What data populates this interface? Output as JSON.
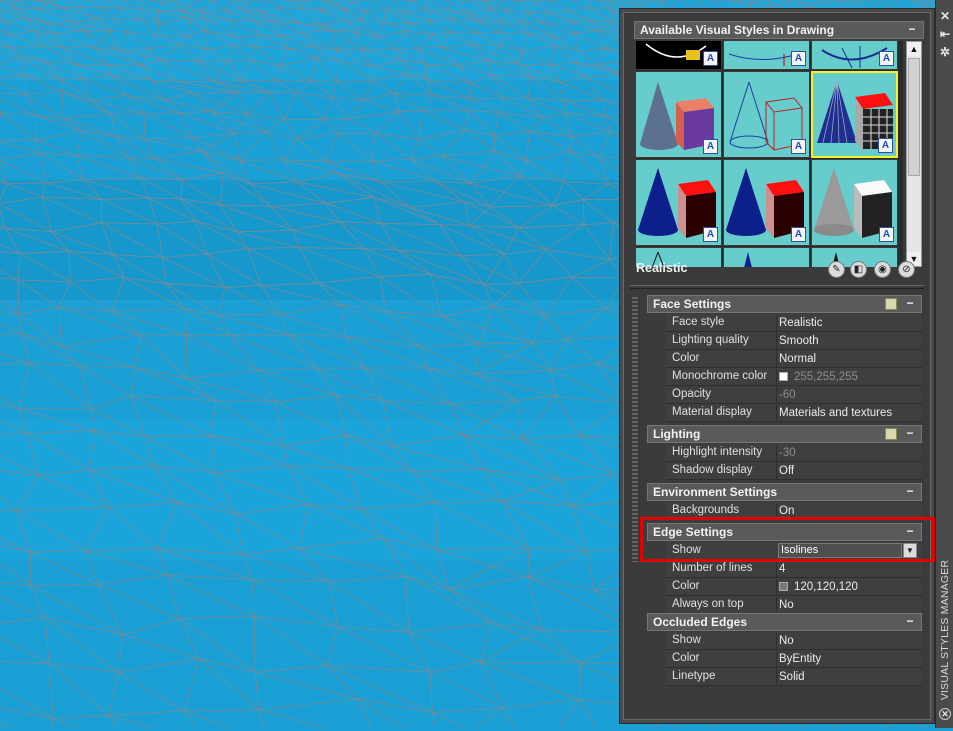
{
  "palette": {
    "title": "VISUAL STYLES MANAGER",
    "strip_buttons": [
      "close-icon",
      "auto-hide-icon",
      "properties-icon"
    ],
    "styles_header": "Available Visual Styles in Drawing",
    "collapse_glyph": "−",
    "current_style": "Realistic",
    "swatch_badge": "A",
    "scroll_up": "▲",
    "scroll_down": "▼",
    "tool_icons": [
      "create-style-icon",
      "apply-to-viewport-icon",
      "export-to-palette-icon",
      "delete-style-icon"
    ]
  },
  "sections": {
    "face": {
      "title": "Face Settings",
      "rows": [
        {
          "label": "Face style",
          "value": "Realistic"
        },
        {
          "label": "Lighting quality",
          "value": "Smooth"
        },
        {
          "label": "Color",
          "value": "Normal"
        },
        {
          "label": "Monochrome color",
          "value": "255,255,255"
        },
        {
          "label": "Opacity",
          "value": "-60"
        },
        {
          "label": "Material display",
          "value": "Materials and textures"
        }
      ]
    },
    "lighting": {
      "title": "Lighting",
      "rows": [
        {
          "label": "Highlight intensity",
          "value": "-30"
        },
        {
          "label": "Shadow display",
          "value": "Off"
        }
      ]
    },
    "environment": {
      "title": "Environment Settings",
      "rows": [
        {
          "label": "Backgrounds",
          "value": "On"
        }
      ]
    },
    "edge": {
      "title": "Edge Settings",
      "rows": [
        {
          "label": "Show",
          "value": "Isolines"
        },
        {
          "label": "Number of lines",
          "value": "4"
        },
        {
          "label": "Color",
          "value": "120,120,120"
        },
        {
          "label": "Always on top",
          "value": "No"
        }
      ]
    },
    "occluded": {
      "title": "Occluded Edges",
      "rows": [
        {
          "label": "Show",
          "value": "No"
        },
        {
          "label": "Color",
          "value": "ByEntity"
        },
        {
          "label": "Linetype",
          "value": "Solid"
        }
      ]
    }
  },
  "colors": {
    "viewport": "#1aa0d4",
    "mesh_lines": "#7b8a93",
    "swatch_bg": "#66cccc",
    "highlight": "#e00000",
    "selected_swatch": "#f1f12d"
  }
}
